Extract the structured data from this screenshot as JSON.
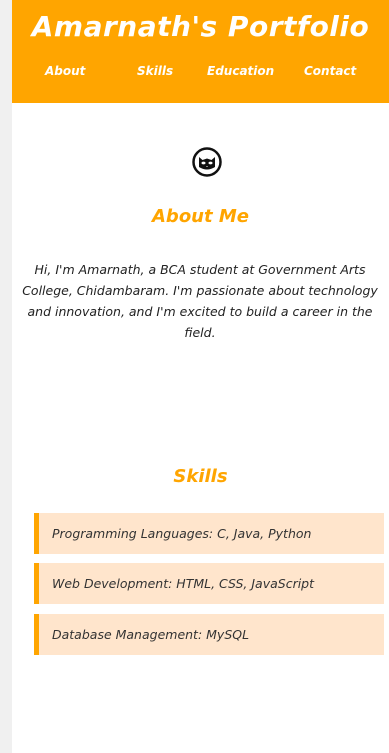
{
  "header": {
    "title": "Amarnath's Portfolio",
    "nav": [
      {
        "label": "About"
      },
      {
        "label": "Skills"
      },
      {
        "label": "Education"
      },
      {
        "label": "Contact"
      }
    ]
  },
  "about": {
    "heading": "About Me",
    "text": "Hi, I'm Amarnath, a BCA student at Government Arts College, Chidambaram. I'm passionate about technology and innovation, and I'm excited to build a career in the field."
  },
  "skills": {
    "heading": "Skills",
    "items": [
      {
        "label": "Programming Languages: C, Java, Python"
      },
      {
        "label": "Web Development: HTML, CSS, JavaScript"
      },
      {
        "label": "Database Management: MySQL"
      }
    ]
  },
  "colors": {
    "accent": "#ffa500",
    "skill_bg": "#ffe5cc",
    "text": "#222222"
  },
  "icons": {
    "avatar": "cat-face-icon"
  }
}
